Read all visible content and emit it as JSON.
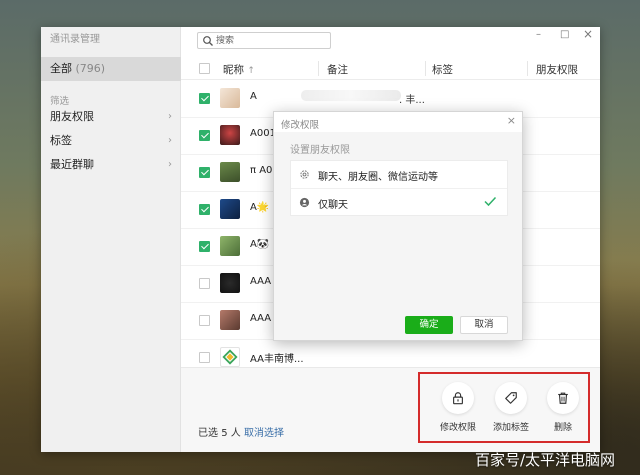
{
  "window": {
    "title": "通讯录管理"
  },
  "sidebar": {
    "all_label": "全部",
    "all_count": "(796)",
    "filter_label": "筛选",
    "items": [
      {
        "label": "朋友权限",
        "chevron": "›"
      },
      {
        "label": "标签",
        "chevron": "›"
      },
      {
        "label": "最近群聊",
        "chevron": "›"
      }
    ]
  },
  "search": {
    "placeholder": "搜索",
    "value": ""
  },
  "window_controls": {
    "minimize": "–",
    "maximize": "□",
    "close": "×"
  },
  "table": {
    "headers": {
      "name": "昵称",
      "sort_indicator": "↑",
      "remark": "备注",
      "tag": "标签",
      "permission": "朋友权限"
    },
    "rows": [
      {
        "name": "A",
        "tail": ". 丰...",
        "checked": true
      },
      {
        "name": "A001",
        "tail": "",
        "checked": true
      },
      {
        "name": "π A0,",
        "tail": "",
        "checked": true
      },
      {
        "name": "A🌟",
        "tail": "",
        "checked": true
      },
      {
        "name": "A🐼",
        "tail": "",
        "checked": true
      },
      {
        "name": "AAA",
        "tail": "",
        "checked": false
      },
      {
        "name": "AAA",
        "tail": "",
        "checked": false
      },
      {
        "name": "AA丰南博...",
        "tail": "",
        "checked": false
      }
    ]
  },
  "footer": {
    "selected_prefix": "已选",
    "selected_count": "5",
    "selected_suffix": "人",
    "cancel_selection": "取消选择"
  },
  "actions": {
    "edit_permission": "修改权限",
    "add_tag": "添加标签",
    "delete": "删除"
  },
  "dialog": {
    "title": "修改权限",
    "close": "×",
    "subtitle": "设置朋友权限",
    "options": [
      {
        "label": "聊天、朋友圈、微信运动等",
        "selected": false
      },
      {
        "label": "仅聊天",
        "selected": true
      }
    ],
    "ok": "确定",
    "cancel": "取消"
  },
  "watermark": "百家号/太平洋电脑网",
  "colors": {
    "accent_green": "#1aad19",
    "checkbox_green": "#2fb16a",
    "highlight_red": "#d42b2b",
    "link_blue": "#3a6fa8"
  }
}
